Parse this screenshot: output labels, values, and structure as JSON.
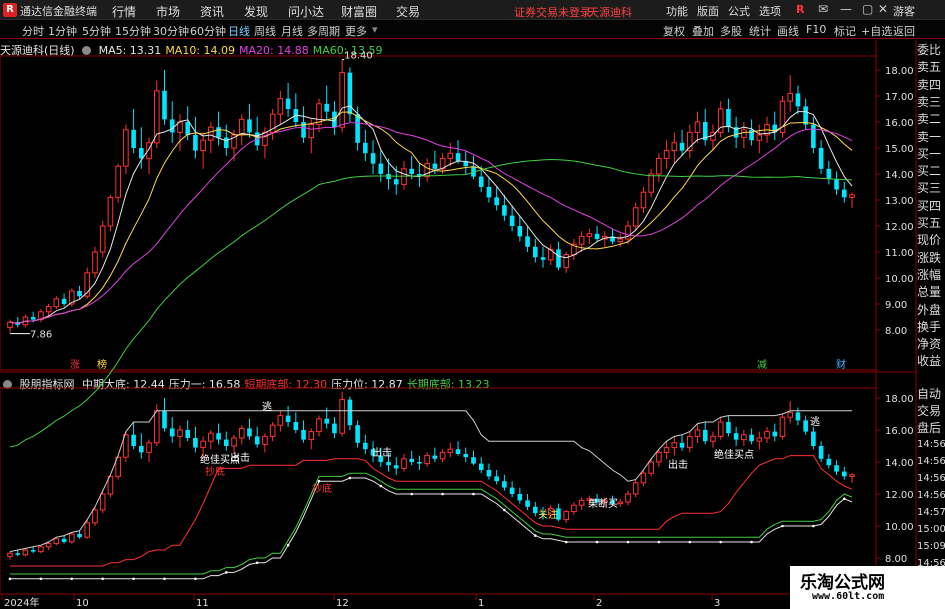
{
  "window": {
    "title": "通达信金融终端",
    "menu": [
      "行情",
      "市场",
      "资讯",
      "发现",
      "问小达",
      "财富圈",
      "交易"
    ],
    "notice": "证券交易未登录",
    "stock_name_top": "天源迪科",
    "right_buttons": [
      "功能",
      "版面",
      "公式",
      "选项"
    ],
    "guest": "游客"
  },
  "toolbar": {
    "timeframes": [
      "分时",
      "1分钟",
      "5分钟",
      "15分钟",
      "30分钟",
      "60分钟",
      "日线",
      "周线",
      "月线",
      "多周期",
      "更多"
    ],
    "active_index": 6,
    "right": [
      "复权",
      "叠加",
      "多股",
      "统计",
      "画线",
      "F10",
      "标记",
      "+自选",
      "返回"
    ]
  },
  "main_chart": {
    "title": "天源迪科(日线)",
    "ma_labels": [
      {
        "text": "MA5: 13.31",
        "color": "#e6e6e6"
      },
      {
        "text": "MA10: 14.09",
        "color": "#ffd84d"
      },
      {
        "text": "MA20: 14.88",
        "color": "#e040e0"
      },
      {
        "text": "MA60: 13.59",
        "color": "#40d040"
      }
    ],
    "high_mark": "18.40",
    "low_mark": "7.86",
    "y_ticks": [
      "18.00",
      "17.00",
      "16.00",
      "15.00",
      "14.00",
      "13.00",
      "12.00",
      "11.00",
      "10.00",
      "9.00",
      "8.00"
    ],
    "event_markers": [
      {
        "text": "涨",
        "color": "#ff3030"
      },
      {
        "text": "榜",
        "color": "#ffd84d"
      },
      {
        "text": "减",
        "color": "#40d040"
      },
      {
        "text": "财",
        "color": "#4ab0ff"
      }
    ]
  },
  "indicator": {
    "name": "股朋指标网",
    "values": [
      {
        "text": "中期大底: 12.44",
        "color": "#e6e6e6"
      },
      {
        "text": "压力一: 16.58",
        "color": "#e6e6e6"
      },
      {
        "text": "短期底部: 12.30",
        "color": "#ff3030"
      },
      {
        "text": "压力位: 12.87",
        "color": "#e6e6e6"
      },
      {
        "text": "长期底部: 13.23",
        "color": "#40d040"
      }
    ],
    "y_ticks": [
      "18.00",
      "16.00",
      "14.00",
      "12.00",
      "10.00",
      "8.00"
    ],
    "signals": [
      {
        "text": "逃",
        "color": "#ffffff"
      },
      {
        "text": "出击",
        "color": "#ffffff"
      },
      {
        "text": "绝佳买点",
        "color": "#ffffff"
      },
      {
        "text": "抄底",
        "color": "#ff3030"
      },
      {
        "text": "出击",
        "color": "#ffffff"
      },
      {
        "text": "抄底",
        "color": "#ff3030"
      },
      {
        "text": "关注",
        "color": "#ffd84d"
      },
      {
        "text": "果断买",
        "color": "#ffffff"
      },
      {
        "text": "出击",
        "color": "#ffffff"
      },
      {
        "text": "绝佳买点",
        "color": "#ffffff"
      },
      {
        "text": "逃",
        "color": "#ffffff"
      }
    ]
  },
  "x_axis": {
    "labels": [
      "2024年",
      "10",
      "11",
      "12",
      "1",
      "2",
      "3"
    ]
  },
  "sidebar": {
    "top_items": [
      "委比",
      "卖五",
      "卖四",
      "卖三",
      "卖二",
      "卖一",
      "买一",
      "买二",
      "买三",
      "买四",
      "买五",
      "现价",
      "涨跌",
      "涨幅",
      "总量",
      "外盘",
      "换手",
      "净资",
      "收益"
    ],
    "bottom_items": [
      "自动",
      "交易",
      "盘后",
      "14:56",
      "14:56",
      "14:56",
      "14:56",
      "14:57",
      "15:00",
      "15:09",
      "14:56"
    ]
  },
  "watermark": {
    "title": "乐淘公式网",
    "url": "www.60lt.com"
  },
  "chart_data": {
    "type": "candlestick",
    "title": "天源迪科(日线)",
    "x_labels": [
      "2024年",
      "10",
      "11",
      "12",
      "1",
      "2",
      "3"
    ],
    "ylim": [
      7.5,
      18.5
    ],
    "candles_ohlc": [
      [
        8.1,
        8.4,
        7.9,
        8.3
      ],
      [
        8.3,
        8.5,
        8.1,
        8.2
      ],
      [
        8.2,
        8.6,
        8.1,
        8.5
      ],
      [
        8.5,
        8.7,
        8.3,
        8.4
      ],
      [
        8.4,
        8.8,
        8.3,
        8.7
      ],
      [
        8.7,
        9.0,
        8.5,
        8.9
      ],
      [
        8.9,
        9.3,
        8.8,
        9.2
      ],
      [
        9.2,
        9.4,
        8.9,
        9.0
      ],
      [
        9.0,
        9.6,
        8.9,
        9.5
      ],
      [
        9.5,
        9.7,
        9.2,
        9.3
      ],
      [
        9.3,
        10.4,
        9.2,
        10.2
      ],
      [
        10.2,
        11.2,
        10.0,
        11.0
      ],
      [
        11.0,
        12.2,
        10.8,
        12.0
      ],
      [
        12.0,
        13.2,
        11.8,
        13.1
      ],
      [
        13.1,
        14.4,
        12.9,
        14.3
      ],
      [
        14.3,
        15.9,
        14.0,
        15.7
      ],
      [
        15.7,
        16.5,
        14.8,
        15.0
      ],
      [
        15.0,
        15.8,
        14.2,
        14.6
      ],
      [
        14.6,
        15.4,
        14.0,
        15.2
      ],
      [
        15.2,
        17.6,
        15.0,
        17.2
      ],
      [
        17.2,
        18.0,
        15.9,
        16.1
      ],
      [
        16.1,
        16.8,
        15.2,
        15.6
      ],
      [
        15.6,
        16.3,
        14.9,
        16.0
      ],
      [
        16.0,
        16.6,
        15.3,
        15.5
      ],
      [
        15.5,
        16.2,
        14.6,
        14.9
      ],
      [
        14.9,
        15.6,
        14.2,
        15.3
      ],
      [
        15.3,
        16.0,
        14.8,
        15.8
      ],
      [
        15.8,
        16.4,
        15.1,
        15.4
      ],
      [
        15.4,
        15.9,
        14.7,
        15.0
      ],
      [
        15.0,
        15.7,
        14.5,
        15.5
      ],
      [
        15.5,
        16.3,
        15.1,
        16.1
      ],
      [
        16.1,
        16.7,
        15.4,
        15.6
      ],
      [
        15.6,
        16.2,
        14.9,
        15.1
      ],
      [
        15.1,
        15.8,
        14.6,
        15.6
      ],
      [
        15.6,
        16.5,
        15.3,
        16.3
      ],
      [
        16.3,
        17.2,
        15.9,
        16.9
      ],
      [
        16.9,
        17.5,
        16.2,
        16.5
      ],
      [
        16.5,
        17.1,
        15.8,
        16.0
      ],
      [
        16.0,
        16.6,
        15.2,
        15.4
      ],
      [
        15.4,
        16.1,
        14.8,
        15.9
      ],
      [
        15.9,
        16.9,
        15.6,
        16.7
      ],
      [
        16.7,
        17.4,
        16.1,
        16.4
      ],
      [
        16.4,
        16.8,
        15.5,
        15.8
      ],
      [
        15.8,
        18.4,
        15.6,
        17.9
      ],
      [
        17.9,
        18.1,
        16.0,
        16.3
      ],
      [
        16.3,
        16.6,
        14.9,
        15.2
      ],
      [
        15.2,
        15.7,
        14.5,
        14.8
      ],
      [
        14.8,
        15.3,
        14.0,
        14.4
      ],
      [
        14.4,
        14.9,
        13.7,
        14.0
      ],
      [
        14.0,
        14.6,
        13.4,
        13.8
      ],
      [
        13.8,
        14.3,
        13.2,
        13.6
      ],
      [
        13.6,
        14.5,
        13.4,
        14.2
      ],
      [
        14.2,
        14.7,
        13.8,
        14.0
      ],
      [
        14.0,
        14.4,
        13.5,
        13.9
      ],
      [
        13.9,
        14.6,
        13.7,
        14.4
      ],
      [
        14.4,
        14.9,
        14.0,
        14.2
      ],
      [
        14.2,
        14.8,
        14.0,
        14.6
      ],
      [
        14.6,
        15.2,
        14.3,
        14.8
      ],
      [
        14.8,
        15.3,
        14.4,
        14.5
      ],
      [
        14.5,
        14.9,
        14.0,
        14.3
      ],
      [
        14.3,
        14.7,
        13.8,
        13.9
      ],
      [
        13.9,
        14.3,
        13.3,
        13.5
      ],
      [
        13.5,
        13.9,
        12.9,
        13.1
      ],
      [
        13.1,
        13.5,
        12.6,
        12.8
      ],
      [
        12.8,
        13.2,
        12.2,
        12.4
      ],
      [
        12.4,
        12.8,
        11.8,
        12.0
      ],
      [
        12.0,
        12.4,
        11.4,
        11.6
      ],
      [
        11.6,
        12.0,
        11.0,
        11.2
      ],
      [
        11.2,
        11.5,
        10.6,
        10.8
      ],
      [
        10.8,
        11.2,
        10.4,
        10.7
      ],
      [
        10.7,
        11.3,
        10.5,
        11.1
      ],
      [
        11.1,
        11.4,
        10.3,
        10.4
      ],
      [
        10.4,
        11.0,
        10.2,
        10.9
      ],
      [
        10.9,
        11.5,
        10.7,
        11.3
      ],
      [
        11.3,
        11.8,
        11.0,
        11.6
      ],
      [
        11.6,
        11.9,
        11.3,
        11.7
      ],
      [
        11.7,
        12.0,
        11.4,
        11.5
      ],
      [
        11.5,
        11.8,
        11.2,
        11.6
      ],
      [
        11.6,
        11.9,
        11.3,
        11.4
      ],
      [
        11.4,
        11.7,
        11.2,
        11.5
      ],
      [
        11.5,
        12.2,
        11.3,
        12.0
      ],
      [
        12.0,
        12.9,
        11.8,
        12.7
      ],
      [
        12.7,
        13.5,
        12.5,
        13.3
      ],
      [
        13.3,
        14.2,
        13.1,
        14.0
      ],
      [
        14.0,
        14.8,
        13.7,
        14.6
      ],
      [
        14.6,
        15.3,
        14.2,
        14.9
      ],
      [
        14.9,
        15.6,
        14.4,
        15.2
      ],
      [
        15.2,
        15.7,
        14.7,
        14.9
      ],
      [
        14.9,
        15.9,
        14.6,
        15.6
      ],
      [
        15.6,
        16.4,
        15.2,
        16.0
      ],
      [
        16.0,
        16.5,
        15.1,
        15.3
      ],
      [
        15.3,
        15.9,
        14.9,
        15.6
      ],
      [
        15.6,
        16.8,
        15.4,
        16.5
      ],
      [
        16.5,
        16.9,
        15.6,
        15.8
      ],
      [
        15.8,
        16.2,
        15.0,
        15.4
      ],
      [
        15.4,
        16.0,
        15.0,
        15.7
      ],
      [
        15.7,
        16.1,
        15.1,
        15.3
      ],
      [
        15.3,
        15.9,
        14.8,
        15.5
      ],
      [
        15.5,
        16.2,
        15.2,
        15.9
      ],
      [
        15.9,
        16.4,
        15.3,
        15.6
      ],
      [
        15.6,
        17.0,
        15.4,
        16.8
      ],
      [
        16.8,
        17.8,
        16.4,
        17.1
      ],
      [
        17.1,
        17.4,
        16.3,
        16.6
      ],
      [
        16.6,
        16.9,
        15.7,
        15.9
      ],
      [
        15.9,
        16.2,
        14.8,
        15.0
      ],
      [
        15.0,
        15.3,
        14.0,
        14.2
      ],
      [
        14.2,
        14.5,
        13.6,
        13.8
      ],
      [
        13.8,
        14.1,
        13.2,
        13.4
      ],
      [
        13.4,
        13.7,
        12.9,
        13.1
      ],
      [
        13.1,
        13.3,
        12.7,
        13.2
      ]
    ]
  }
}
